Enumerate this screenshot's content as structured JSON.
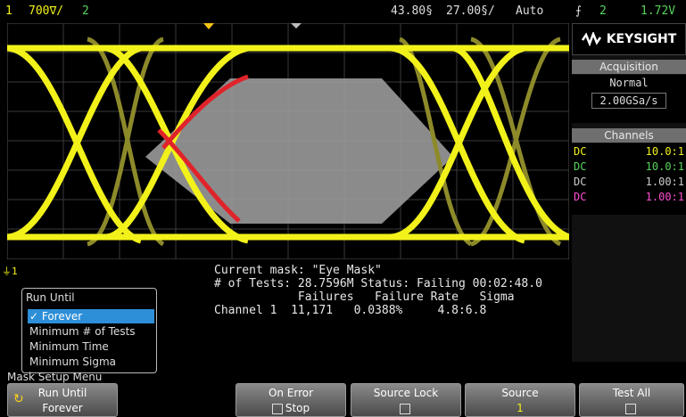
{
  "topbar": {
    "ch1_label": "1",
    "ch1_scale": "700∇/",
    "ch2_label": "2",
    "time_delay": "43.80§",
    "time_scale": "27.00§/",
    "trigger_mode": "Auto",
    "trigger_icon": "⨍",
    "trigger_channel": "2",
    "trigger_level": "1.72V"
  },
  "brand": {
    "logo_text": "KEYSIGHT",
    "logo_icon": "keysight-wave-icon"
  },
  "acquisition": {
    "header": "Acquisition",
    "mode": "Normal",
    "rate": "2.00GSa/s"
  },
  "channels": {
    "header": "Channels",
    "rows": [
      {
        "coupling": "DC",
        "ratio": "10.0:1",
        "color": "#f2f21a"
      },
      {
        "coupling": "DC",
        "ratio": "10.0:1",
        "color": "#57d35c"
      },
      {
        "coupling": "DC",
        "ratio": "1.00:1",
        "color": "#6aa6ff"
      },
      {
        "coupling": "DC",
        "ratio": "1.00:1",
        "color": "#ff4fd1"
      }
    ]
  },
  "mask_info": {
    "current_mask_label": "Current mask:",
    "current_mask": "\"Eye Mask\"",
    "tests_label": "# of Tests:",
    "tests": "28.7596M",
    "status_label": "Status:",
    "status": "Failing",
    "elapsed": "00:02:48.0",
    "col_failures": "Failures",
    "col_failure_rate": "Failure Rate",
    "col_sigma": "Sigma",
    "channel_label": "Channel 1",
    "failures": "11,171",
    "failure_rate": "0.0388%",
    "sigma": "4.8:6.8"
  },
  "run_until_menu": {
    "title": "Run Until",
    "items": [
      "✓ Forever",
      "Minimum # of Tests",
      "Minimum Time",
      "Minimum Sigma"
    ],
    "selected_index": 0
  },
  "bottom_label": "Mask Setup Menu",
  "ground_marker": "1",
  "softkeys": [
    {
      "line1": "Run Until",
      "line2": "Forever"
    },
    {
      "line1": "On Error",
      "line2": "Stop"
    },
    {
      "line1": "Source Lock",
      "line2": ""
    },
    {
      "line1": "Source",
      "line2": "1"
    },
    {
      "line1": "Test All",
      "line2": ""
    }
  ],
  "colors": {
    "trace": "#f2f21a",
    "trace_dim": "#8d8a2a",
    "mask": "#9a9a9a",
    "violation": "#e0232a",
    "accent": "#2d8fd8"
  }
}
